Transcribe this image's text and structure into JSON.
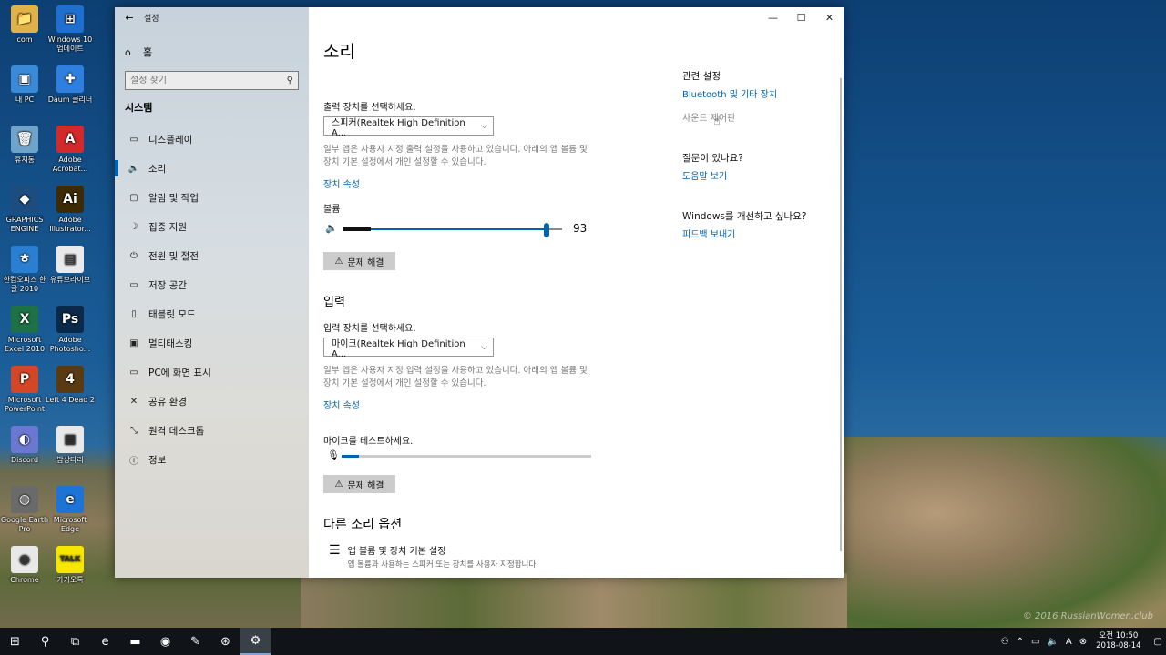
{
  "desktop": {
    "icons": [
      {
        "label": "com",
        "color": "#e0b24a",
        "glyph": "📁"
      },
      {
        "label": "Windows 10 업데이트",
        "color": "#1f6fd1",
        "glyph": "⊞"
      },
      {
        "label": "내 PC",
        "color": "#3a8ad8",
        "glyph": "▣"
      },
      {
        "label": "Daum 클리너",
        "color": "#2f7fe0",
        "glyph": "✚"
      },
      {
        "label": "휴지통",
        "color": "#6fa3c9",
        "glyph": "🗑"
      },
      {
        "label": "Adobe Acrobat...",
        "color": "#d12a2a",
        "glyph": "A"
      },
      {
        "label": "GRAPHICS ENGINE",
        "color": "#1c4c80",
        "glyph": "◆"
      },
      {
        "label": "Adobe Illustrator...",
        "color": "#3d2a07",
        "glyph": "Ai"
      },
      {
        "label": "한컴오피스 한글 2010",
        "color": "#2a7fd0",
        "glyph": "ㅎ"
      },
      {
        "label": "유튜브라이브",
        "color": "#eaeaea",
        "glyph": "▤"
      },
      {
        "label": "Microsoft Excel 2010",
        "color": "#1e7145",
        "glyph": "X"
      },
      {
        "label": "Adobe Photosho...",
        "color": "#0b2a4a",
        "glyph": "Ps"
      },
      {
        "label": "Microsoft PowerPoint",
        "color": "#d24726",
        "glyph": "P"
      },
      {
        "label": "Left 4 Dead 2",
        "color": "#5a3a12",
        "glyph": "4"
      },
      {
        "label": "Discord",
        "color": "#6a78d1",
        "glyph": "◐"
      },
      {
        "label": "밥상다리",
        "color": "#e8e8e8",
        "glyph": "▦"
      },
      {
        "label": "Google Earth Pro",
        "color": "#6a6a6a",
        "glyph": "◍"
      },
      {
        "label": "Microsoft Edge",
        "color": "#1e73d6",
        "glyph": "e"
      },
      {
        "label": "Chrome",
        "color": "#e8e8e8",
        "glyph": "◉"
      },
      {
        "label": "카카오톡",
        "color": "#f7e600",
        "glyph": "TALK"
      }
    ],
    "watermark": "© 2016 RussianWomen.club"
  },
  "window": {
    "title": "설정",
    "controls": {
      "minimize": "—",
      "maximize": "☐",
      "close": "✕"
    }
  },
  "sidebar": {
    "back_icon": "←",
    "home_label": "홈",
    "search_placeholder": "설정 찾기",
    "section": "시스템",
    "items": [
      {
        "icon": "▭",
        "label": "디스플레이"
      },
      {
        "icon": "🔈",
        "label": "소리"
      },
      {
        "icon": "▢",
        "label": "알림 및 작업"
      },
      {
        "icon": "☽",
        "label": "집중 지원"
      },
      {
        "icon": "⏻",
        "label": "전원 및 절전"
      },
      {
        "icon": "▭",
        "label": "저장 공간"
      },
      {
        "icon": "▯",
        "label": "태블릿 모드"
      },
      {
        "icon": "▣",
        "label": "멀티태스킹"
      },
      {
        "icon": "▭",
        "label": "PC에 화면 표시"
      },
      {
        "icon": "✕",
        "label": "공유 환경"
      },
      {
        "icon": "⤡",
        "label": "원격 데스크톱"
      },
      {
        "icon": "ⓘ",
        "label": "정보"
      }
    ],
    "active_index": 1
  },
  "main": {
    "title": "소리",
    "output": {
      "label": "출력 장치를 선택하세요.",
      "device": "스피커(Realtek High Definition A...",
      "desc": "일부 앱은 사용자 지정 출력 설정을 사용하고 있습니다. 아래의 앱 볼륨 및 장치 기본 설정에서 개인 설정할 수 있습니다.",
      "props_link": "장치 속성",
      "volume_label": "볼륨",
      "volume_value": "93",
      "volume_fraction": 0.93,
      "troubleshoot": "문제 해결"
    },
    "input": {
      "heading": "입력",
      "label": "입력 장치를 선택하세요.",
      "device": "마이크(Realtek High Definition A...",
      "desc": "일부 앱은 사용자 지정 입력 설정을 사용하고 있습니다. 아래의 앱 볼륨 및 장치 기본 설정에서 개인 설정할 수 있습니다.",
      "props_link": "장치 속성",
      "test_label": "마이크를 테스트하세요.",
      "mic_level_fraction": 0.07,
      "troubleshoot": "문제 해결"
    },
    "other": {
      "heading": "다른 소리 옵션",
      "app_volume_title": "앱 볼륨 및 장치 기본 설정",
      "app_volume_desc": "앱 볼륨과 사용하는 스피커 또는 장치를 사용자 지정합니다."
    }
  },
  "related": {
    "title": "관련 설정",
    "bluetooth_link": "Bluetooth 및 기타 장치",
    "sound_panel_link": "사운드 제어판",
    "question_title": "질문이 있나요?",
    "help_link": "도움말 보기",
    "improve_title": "Windows를 개선하고 싶나요?",
    "feedback_link": "피드백 보내기"
  },
  "taskbar": {
    "start_icon": "⊞",
    "search_icon": "⚲",
    "taskview_icon": "⧉",
    "apps": [
      {
        "name": "edge",
        "glyph": "e"
      },
      {
        "name": "explorer",
        "glyph": "▬"
      },
      {
        "name": "chrome",
        "glyph": "◉"
      },
      {
        "name": "paint",
        "glyph": "✎"
      },
      {
        "name": "steam-like",
        "glyph": "⊛"
      },
      {
        "name": "settings",
        "glyph": "⚙"
      }
    ],
    "time": "오전 10:50",
    "date": "2018-08-14"
  },
  "colors": {
    "accent": "#0063b1",
    "taskbar": "#101419"
  }
}
